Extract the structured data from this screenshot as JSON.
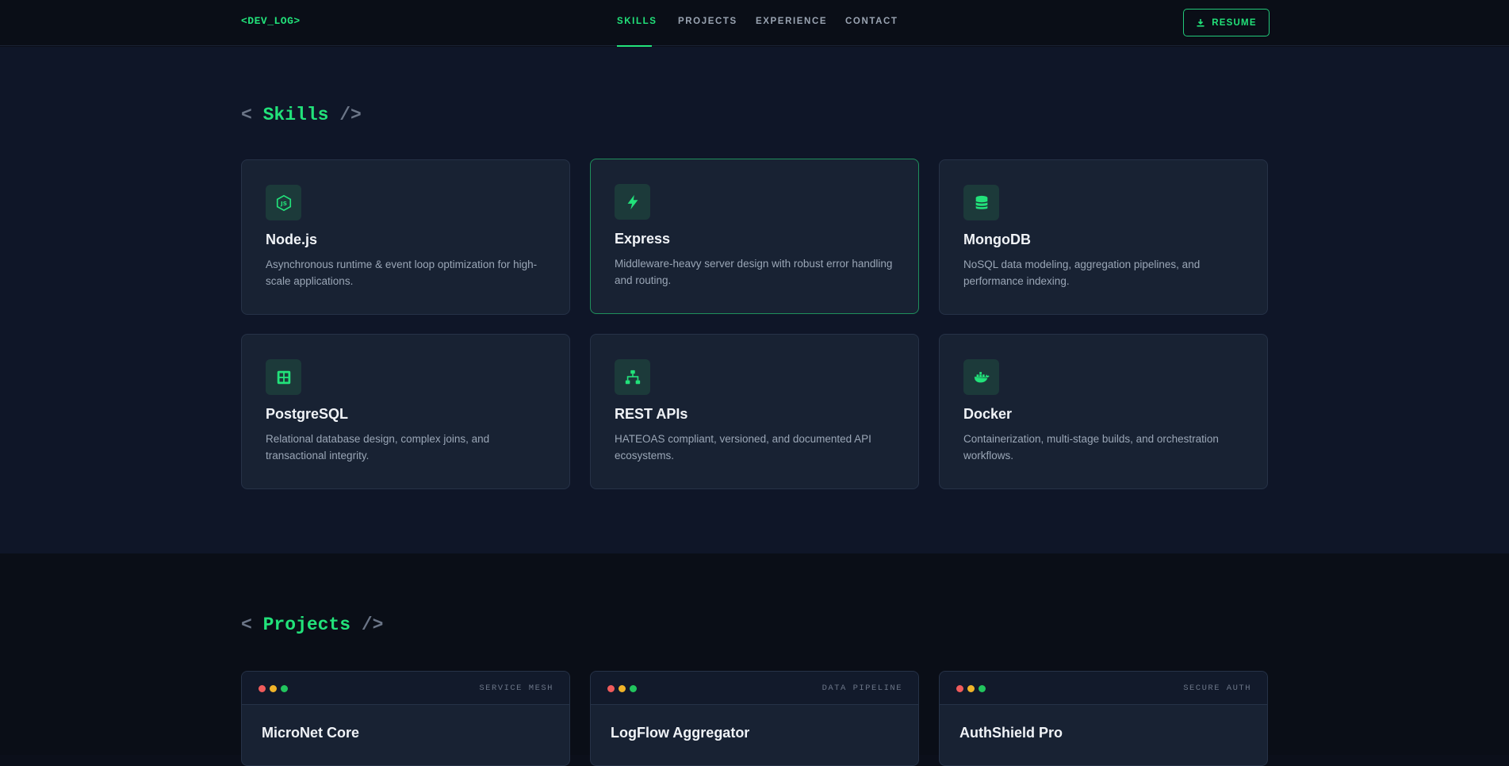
{
  "navbar": {
    "logo": "<DEV_LOG>",
    "links": [
      {
        "label": "SKILLS",
        "active": true
      },
      {
        "label": "PROJECTS",
        "active": false
      },
      {
        "label": "EXPERIENCE",
        "active": false
      },
      {
        "label": "CONTACT",
        "active": false
      }
    ],
    "resume_label": "RESUME"
  },
  "skills": {
    "title_open": "< ",
    "title_word": "Skills",
    "title_close": " />",
    "items": [
      {
        "name": "Node.js",
        "desc": "Asynchronous runtime & event loop optimization for high-scale applications.",
        "icon": "nodejs-icon"
      },
      {
        "name": "Express",
        "desc": "Middleware-heavy server design with robust error handling and routing.",
        "icon": "bolt-icon"
      },
      {
        "name": "MongoDB",
        "desc": "NoSQL data modeling, aggregation pipelines, and performance indexing.",
        "icon": "database-icon"
      },
      {
        "name": "PostgreSQL",
        "desc": "Relational database design, complex joins, and transactional integrity.",
        "icon": "table-icon"
      },
      {
        "name": "REST APIs",
        "desc": "HATEOAS compliant, versioned, and documented API ecosystems.",
        "icon": "network-icon"
      },
      {
        "name": "Docker",
        "desc": "Containerization, multi-stage builds, and orchestration workflows.",
        "icon": "docker-icon"
      }
    ]
  },
  "projects": {
    "title_open": "< ",
    "title_word": "Projects",
    "title_close": " />",
    "items": [
      {
        "tag": "SERVICE MESH",
        "name": "MicroNet Core"
      },
      {
        "tag": "DATA PIPELINE",
        "name": "LogFlow Aggregator"
      },
      {
        "tag": "SECURE AUTH",
        "name": "AuthShield Pro"
      }
    ]
  },
  "colors": {
    "accent": "#22e27a",
    "background": "#0b0f1a",
    "card": "#182233"
  }
}
